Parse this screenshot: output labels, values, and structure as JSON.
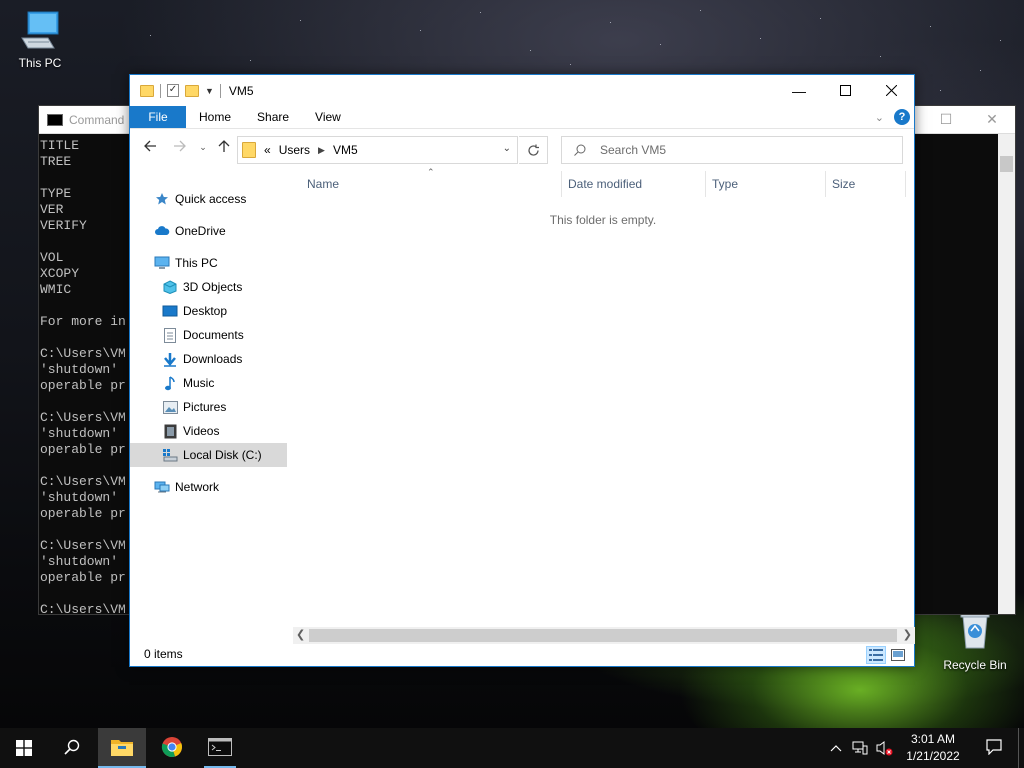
{
  "desktop": {
    "icons": [
      {
        "label": "This PC"
      },
      {
        "label": "Recycle Bin"
      }
    ]
  },
  "cmd": {
    "title": "Command",
    "lines": "TITLE\nTREE\n\nTYPE\nVER\nVERIFY\n\nVOL\nXCOPY\nWMIC\n\nFor more in\n\nC:\\Users\\VM\n'shutdown' \noperable pr\n\nC:\\Users\\VM\n'shutdown' \noperable pr\n\nC:\\Users\\VM\n'shutdown' \noperable pr\n\nC:\\Users\\VM\n'shutdown' \noperable pr\n\nC:\\Users\\VM"
  },
  "explorer": {
    "title": "VM5",
    "ribbon": {
      "tabs": [
        "File",
        "Home",
        "Share",
        "View"
      ],
      "help": "?"
    },
    "address": {
      "overflow": "«",
      "crumbs": [
        "Users",
        "VM5"
      ]
    },
    "search": {
      "placeholder": "Search VM5"
    },
    "nav": {
      "quick_access": "Quick access",
      "onedrive": "OneDrive",
      "this_pc": "This PC",
      "objects_3d": "3D Objects",
      "desktop": "Desktop",
      "documents": "Documents",
      "downloads": "Downloads",
      "music": "Music",
      "pictures": "Pictures",
      "videos": "Videos",
      "local_disk": "Local Disk (C:)",
      "network": "Network"
    },
    "columns": [
      "Name",
      "Date modified",
      "Type",
      "Size"
    ],
    "empty_message": "This folder is empty.",
    "status": {
      "items": "0 items"
    }
  },
  "taskbar": {
    "clock": {
      "time": "3:01 AM",
      "date": "1/21/2022"
    }
  },
  "colors": {
    "accent": "#1979ca",
    "selection": "#cce8ff",
    "taskbar": "#101010"
  }
}
